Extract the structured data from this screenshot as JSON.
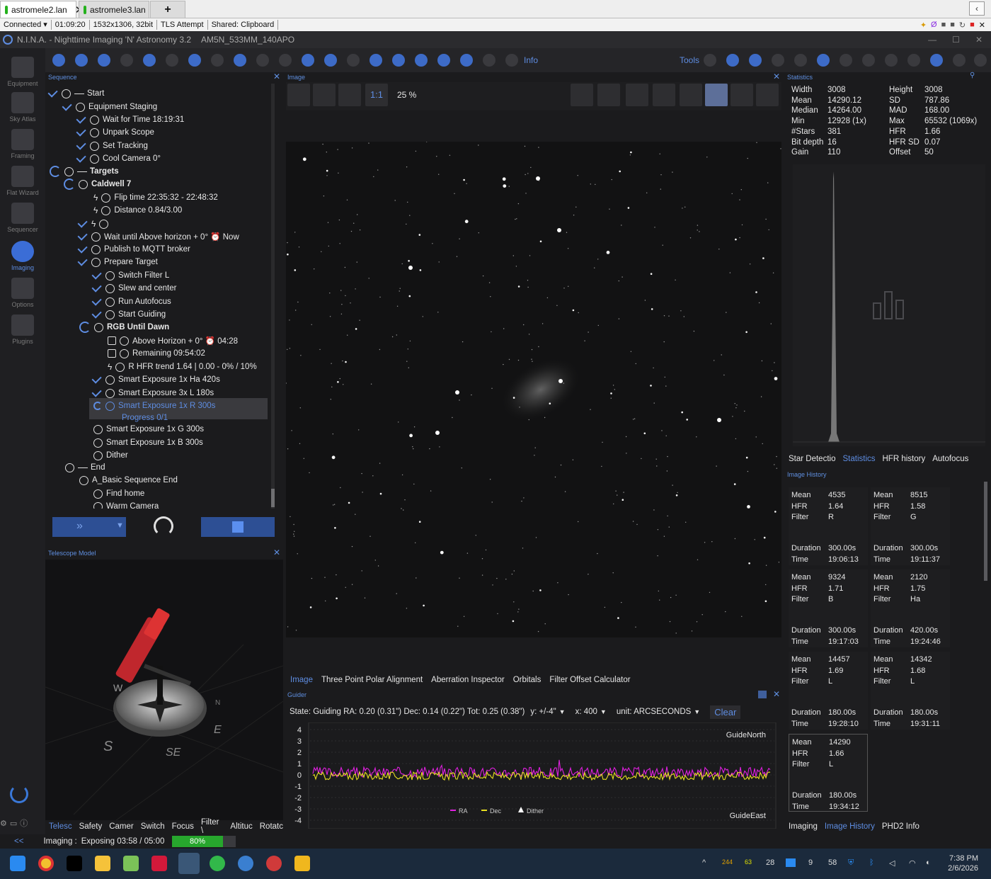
{
  "browser": {
    "tabs": [
      {
        "label": "astromele2.lan",
        "active": true,
        "close": "✕"
      },
      {
        "label": "astromele3.lan",
        "active": false
      }
    ],
    "new_tab": "+"
  },
  "connection": {
    "status": "Connected",
    "elapsed": "01:09:20",
    "resolution": "1532x1306, 32bit",
    "tls": "TLS Attempt",
    "shared": "Shared: Clipboard"
  },
  "window": {
    "title": "N.I.N.A. - Nighttime Imaging 'N' Astronomy 3.2",
    "profile": "AM5N_533MM_140APO"
  },
  "sidebar": [
    {
      "label": "Equipment",
      "icon": "equipment-icon",
      "active": false
    },
    {
      "label": "Sky Atlas",
      "icon": "sky-atlas-icon",
      "active": false
    },
    {
      "label": "Framing",
      "icon": "framing-icon",
      "active": false
    },
    {
      "label": "Flat Wizard",
      "icon": "flat-wizard-icon",
      "active": false
    },
    {
      "label": "Sequencer",
      "icon": "sequencer-icon",
      "active": false
    },
    {
      "label": "Imaging",
      "icon": "imaging-icon",
      "active": true
    },
    {
      "label": "Options",
      "icon": "options-icon",
      "active": false
    },
    {
      "label": "Plugins",
      "icon": "plugins-icon",
      "active": false
    }
  ],
  "toolbar": {
    "info": "Info",
    "tools": "Tools"
  },
  "sequence": {
    "title": "Sequence",
    "items": [
      {
        "text": "Start",
        "type": "container-check"
      },
      {
        "text": "Equipment Staging",
        "type": "container-check"
      },
      {
        "text": "Wait for Time 18:19:31",
        "type": "check"
      },
      {
        "text": "Unpark Scope",
        "type": "check"
      },
      {
        "text": "Set Tracking",
        "type": "check"
      },
      {
        "text": "Cool Camera 0°",
        "type": "check"
      },
      {
        "text": "Targets",
        "type": "spinner"
      },
      {
        "text": "Caldwell 7",
        "type": "spinner"
      },
      {
        "text": "Flip time 22:35:32  -  22:48:32",
        "type": "bolt"
      },
      {
        "text": "Distance 0.84/3.00",
        "type": "bolt"
      },
      {
        "text": "",
        "type": "check-bolt"
      },
      {
        "text": "Wait until Above horizon + 0°  ⏰ Now",
        "type": "check"
      },
      {
        "text": "Publish to MQTT broker",
        "type": "check"
      },
      {
        "text": "Prepare Target",
        "type": "check"
      },
      {
        "text": "Switch Filter L",
        "type": "check"
      },
      {
        "text": "Slew and center",
        "type": "check"
      },
      {
        "text": "Run Autofocus",
        "type": "check"
      },
      {
        "text": "Start Guiding",
        "type": "check"
      },
      {
        "text": "RGB Until Dawn",
        "type": "spinner"
      },
      {
        "text": "Above Horizon + 0°  ⏰ 04:28",
        "type": "box"
      },
      {
        "text": "Remaining 09:54:02",
        "type": "box"
      },
      {
        "text": "R HFR trend  1.64 | 0.00 - 0% / 10%",
        "type": "bolt"
      },
      {
        "text": "Smart Exposure  1x  Ha  420s",
        "type": "check"
      },
      {
        "text": "Smart Exposure  3x  L  180s",
        "type": "check"
      },
      {
        "text": "Smart Exposure  1x  R  300s",
        "type": "active"
      },
      {
        "text": "Progress  0/1",
        "type": "active-sub"
      },
      {
        "text": "Smart Exposure  1x  G  300s",
        "type": "plain"
      },
      {
        "text": "Smart Exposure  1x  B  300s",
        "type": "plain"
      },
      {
        "text": "Dither",
        "type": "plain"
      },
      {
        "text": "End",
        "type": "plain"
      },
      {
        "text": "A_Basic Sequence End",
        "type": "plain"
      },
      {
        "text": "Find home",
        "type": "plain"
      },
      {
        "text": "Warm Camera",
        "type": "plain"
      }
    ]
  },
  "telescope_model": {
    "title": "Telescope Model",
    "compass": [
      "W",
      "S",
      "SE",
      "E",
      "N"
    ],
    "tabs": [
      "Telesc",
      "Safety",
      "Camer",
      "Switch",
      "Focus",
      "Filter \\",
      "Altituc",
      "Rotatc"
    ]
  },
  "image_panel": {
    "title": "Image",
    "zoom_11": "1:1",
    "zoom_level": "25 %",
    "tabs": [
      "Image",
      "Three Point Polar Alignment",
      "Aberration Inspector",
      "Orbitals",
      "Filter Offset Calculator"
    ]
  },
  "guider": {
    "title": "Guider",
    "state": "State: Guiding  RA: 0.20 (0.31\")  Dec: 0.14 (0.22\")  Tot: 0.25 (0.38\")",
    "y_range": "y: +/-4\"",
    "x_range": "x: 400",
    "unit": "unit: ARCSECONDS",
    "clear": "Clear",
    "y_ticks": [
      "4",
      "3",
      "2",
      "1",
      "0",
      "-1",
      "-2",
      "-3",
      "-4"
    ],
    "north_label": "GuideNorth",
    "east_label": "GuideEast",
    "legend": [
      "RA",
      "Dec",
      "Dither"
    ],
    "colors": {
      "ra": "#e020e0",
      "dec": "#e8e020"
    }
  },
  "statistics": {
    "title": "Statistics",
    "left": [
      [
        "Width",
        "3008"
      ],
      [
        "Mean",
        "14290.12"
      ],
      [
        "Median",
        "14264.00"
      ],
      [
        "Min",
        "12928 (1x)"
      ],
      [
        "#Stars",
        "381"
      ],
      [
        "Bit depth",
        "16"
      ],
      [
        "Gain",
        "110"
      ]
    ],
    "right": [
      [
        "Height",
        "3008"
      ],
      [
        "SD",
        "787.86"
      ],
      [
        "MAD",
        "168.00"
      ],
      [
        "Max",
        "65532 (1069x)"
      ],
      [
        "HFR",
        "1.66"
      ],
      [
        "HFR SD",
        "0.07"
      ],
      [
        "Offset",
        "50"
      ]
    ],
    "tabs": [
      "Star Detectio",
      "Statistics",
      "HFR history",
      "Autofocus"
    ]
  },
  "image_history": {
    "title": "Image History",
    "cards": [
      {
        "mean": "4535",
        "hfr": "1.64",
        "filter": "R",
        "duration": "300.00s",
        "time": "19:06:13"
      },
      {
        "mean": "8515",
        "hfr": "1.58",
        "filter": "G",
        "duration": "300.00s",
        "time": "19:11:37"
      },
      {
        "mean": "9324",
        "hfr": "1.71",
        "filter": "B",
        "duration": "300.00s",
        "time": "19:17:03"
      },
      {
        "mean": "2120",
        "hfr": "1.75",
        "filter": "Ha",
        "duration": "420.00s",
        "time": "19:24:46"
      },
      {
        "mean": "14457",
        "hfr": "1.69",
        "filter": "L",
        "duration": "180.00s",
        "time": "19:28:10"
      },
      {
        "mean": "14342",
        "hfr": "1.68",
        "filter": "L",
        "duration": "180.00s",
        "time": "19:31:11"
      },
      {
        "mean": "14290",
        "hfr": "1.66",
        "filter": "L",
        "duration": "180.00s",
        "time": "19:34:12"
      }
    ],
    "labels": {
      "mean": "Mean",
      "hfr": "HFR",
      "filter": "Filter",
      "duration": "Duration",
      "time": "Time"
    },
    "tabs": [
      "Imaging",
      "Image History",
      "PHD2 Info"
    ]
  },
  "status_bar": {
    "collapse": "<<",
    "imaging": "Imaging :",
    "exposing": "Exposing 03:58 / 05:00",
    "progress": "80%",
    "progress_fraction": 0.8
  },
  "taskbar": {
    "tray": [
      "244",
      "63",
      "28",
      "9",
      "58"
    ],
    "time": "7:38 PM",
    "date": "2/6/2026"
  }
}
